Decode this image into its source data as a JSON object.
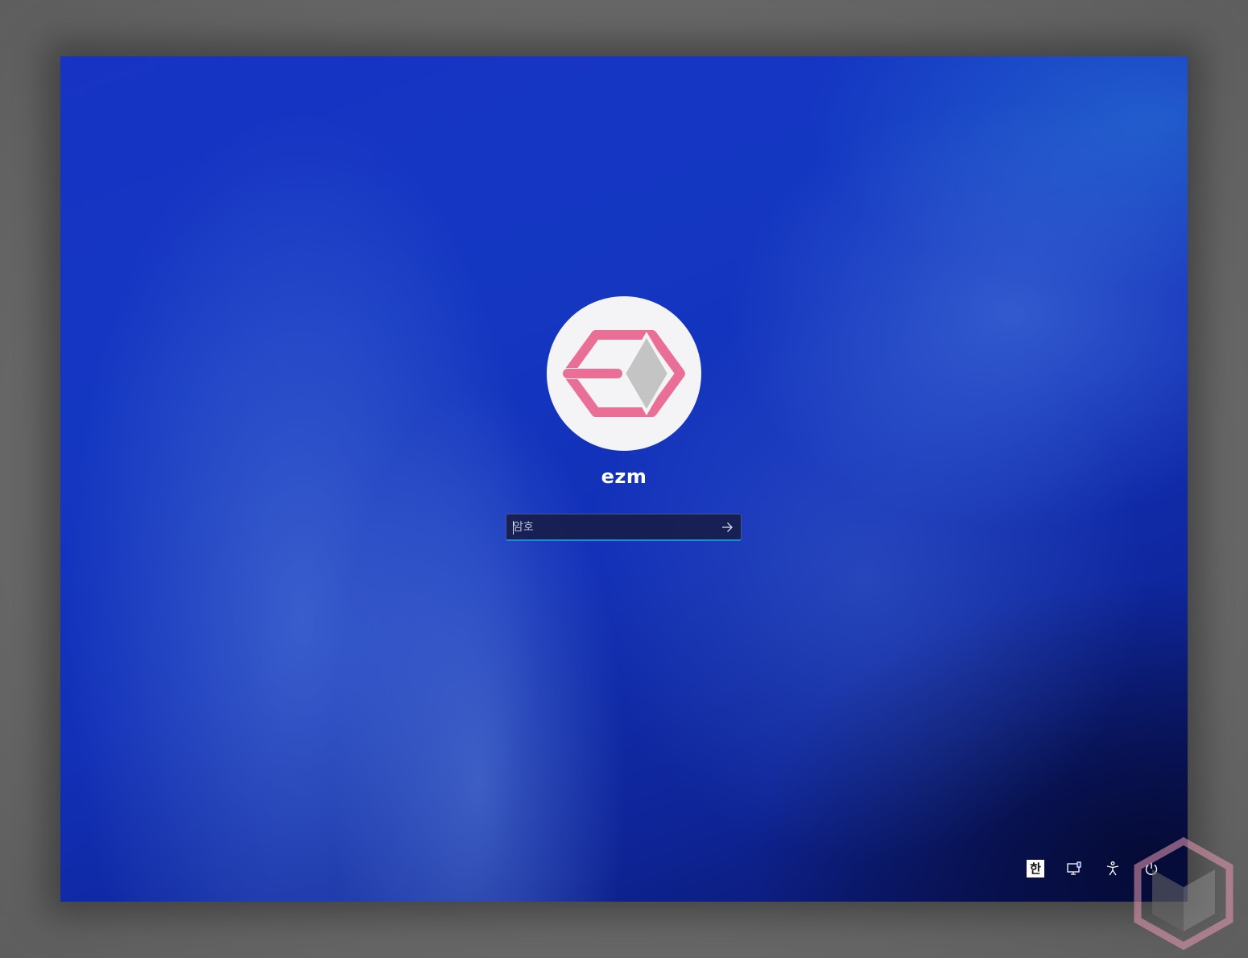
{
  "user": {
    "name": "ezm",
    "avatar_icon": "ezm-logo-hexagon-icon"
  },
  "password": {
    "placeholder": "암호",
    "value": "",
    "submit_icon": "arrow-right-icon"
  },
  "tray": {
    "ime_label": "한",
    "network_icon": "network-monitor-icon",
    "accessibility_icon": "accessibility-icon",
    "power_icon": "power-icon"
  },
  "colors": {
    "background": "#1437c2",
    "logo_pink": "#ea6f97",
    "logo_gray": "#c4c4c4",
    "focus_underline": "#1e8bd0"
  }
}
